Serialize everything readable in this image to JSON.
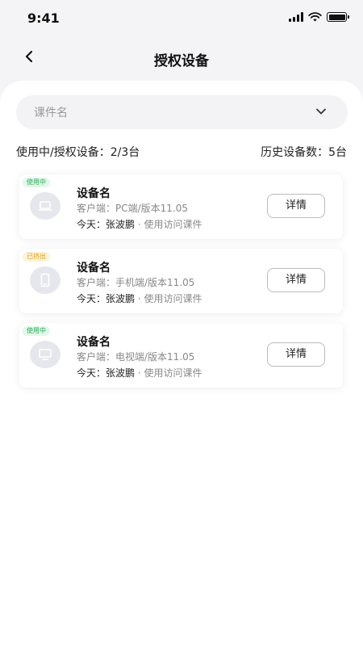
{
  "status_bar": {
    "time": "9:41"
  },
  "nav": {
    "title": "授权设备"
  },
  "filter": {
    "placeholder": "课件名"
  },
  "summary": {
    "in_use": "使用中/授权设备：2/3台",
    "history": "历史设备数：5台"
  },
  "devices": [
    {
      "badge": "使用中",
      "badge_color": "#2faa5a",
      "icon": "laptop-icon",
      "name": "设备名",
      "client": "客户端：PC端/版本11.05",
      "today_label": "今天：",
      "user": "张波鹏",
      "action": "· 使用访问课件",
      "button": "详情"
    },
    {
      "badge": "已挤出",
      "badge_color": "#e0a01a",
      "icon": "phone-icon",
      "name": "设备名",
      "client": "客户端：手机端/版本11.05",
      "today_label": "今天：",
      "user": "张波鹏",
      "action": "· 使用访问课件",
      "button": "详情"
    },
    {
      "badge": "使用中",
      "badge_color": "#2faa5a",
      "icon": "tv-icon",
      "name": "设备名",
      "client": "客户端：电视端/版本11.05",
      "today_label": "今天：",
      "user": "张波鹏",
      "action": "· 使用访问课件",
      "button": "详情"
    }
  ]
}
